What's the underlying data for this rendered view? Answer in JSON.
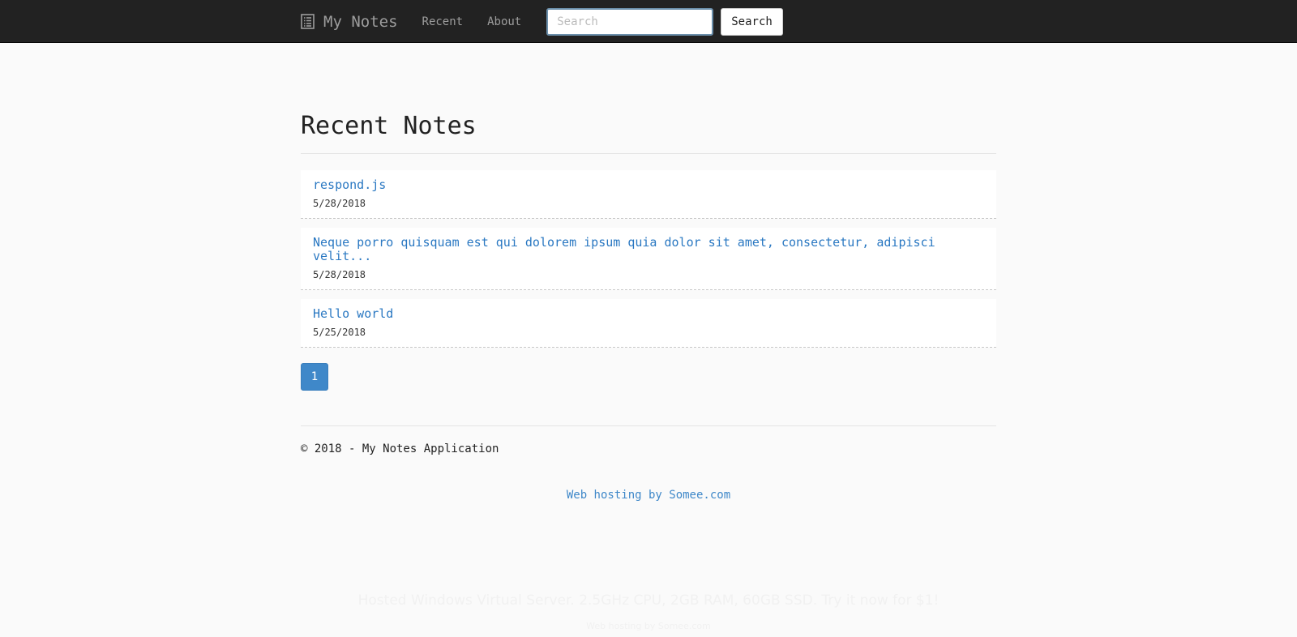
{
  "navbar": {
    "brand_icon": "notes-list-icon",
    "brand_label": "My Notes",
    "links": [
      {
        "label": "Recent"
      },
      {
        "label": "About"
      }
    ],
    "search": {
      "placeholder": "Search",
      "value": "",
      "button_label": "Search"
    }
  },
  "main": {
    "title": "Recent Notes",
    "notes": [
      {
        "title": "respond.js",
        "date": "5/28/2018"
      },
      {
        "title": "Neque porro quisquam est qui dolorem ipsum quia dolor sit amet, consectetur, adipisci velit...",
        "date": "5/28/2018"
      },
      {
        "title": "Hello world",
        "date": "5/25/2018"
      }
    ],
    "pagination": {
      "pages": [
        "1"
      ],
      "current": "1"
    }
  },
  "footer": {
    "copyright": "© 2018 - My Notes Application",
    "hosting_link": "Web hosting by Somee.com",
    "ad_line": "Hosted Windows Virtual Server. 2.5GHz CPU, 2GB RAM, 60GB SSD. Try it now for $1!",
    "ad_small": "Web hosting by Somee.com"
  },
  "colors": {
    "navbar_bg": "#222222",
    "link_blue": "#2a78c2",
    "accent_blue": "#3f88c9",
    "page_bg": "#fafafa"
  }
}
